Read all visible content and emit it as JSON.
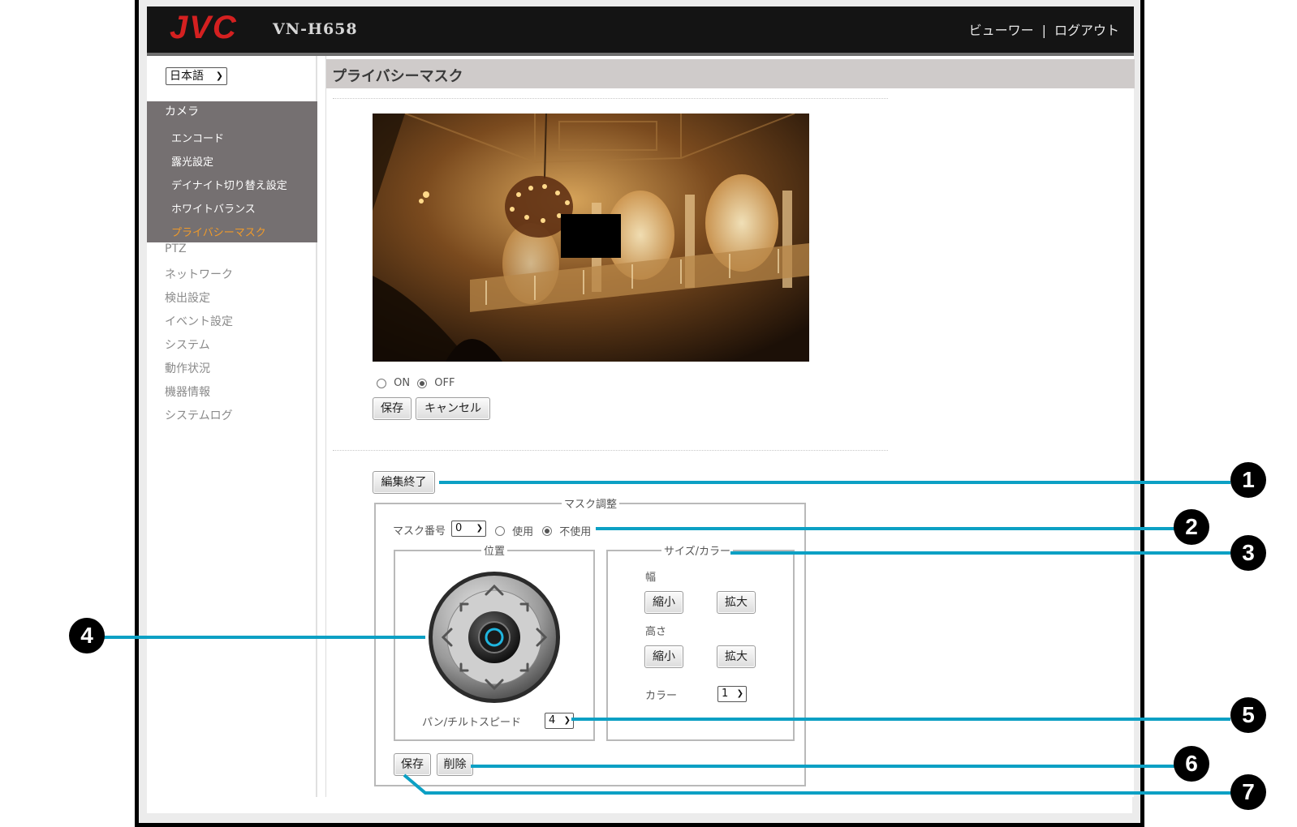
{
  "header": {
    "logo": "JVC",
    "model": "VN-H658",
    "link_viewer": "ビューワー",
    "separator": "|",
    "link_logout": "ログアウト"
  },
  "sidebar": {
    "language": "日本語",
    "camera_label": "カメラ",
    "camera_items": [
      {
        "label": "エンコード"
      },
      {
        "label": "露光設定"
      },
      {
        "label": "デイナイト切り替え設定"
      },
      {
        "label": "ホワイトバランス"
      },
      {
        "label": "プライバシーマスク",
        "active": true
      }
    ],
    "items": [
      {
        "label": "PTZ"
      },
      {
        "label": "ネットワーク"
      },
      {
        "label": "検出設定"
      },
      {
        "label": "イベント設定"
      },
      {
        "label": "システム"
      },
      {
        "label": "動作状況"
      },
      {
        "label": "機器情報"
      },
      {
        "label": "システムログ"
      }
    ]
  },
  "page": {
    "title": "プライバシーマスク",
    "on_label": "ON",
    "off_label": "OFF",
    "onoff_selected": "OFF",
    "save_label": "保存",
    "cancel_label": "キャンセル",
    "edit_end_label": "編集終了"
  },
  "mask_adjust": {
    "legend": "マスク調整",
    "mask_number_label": "マスク番号",
    "mask_number_value": "0",
    "use_label": "使用",
    "unused_label": "不使用",
    "use_selected": "不使用",
    "position_legend": "位置",
    "pan_tilt_speed_label": "パン/チルトスピード",
    "pan_tilt_speed_value": "4",
    "size_color_legend": "サイズ/カラー",
    "width_label": "幅",
    "height_label": "高さ",
    "shrink_label": "縮小",
    "enlarge_label": "拡大",
    "color_label": "カラー",
    "color_value": "1",
    "save_label": "保存",
    "delete_label": "削除"
  },
  "callouts": [
    "1",
    "2",
    "3",
    "4",
    "5",
    "6",
    "7"
  ],
  "colors": {
    "header_bg": "#141414",
    "logo_red": "#d42020",
    "active_nav": "#f09a2a",
    "callout_line": "#0ca0c4"
  }
}
